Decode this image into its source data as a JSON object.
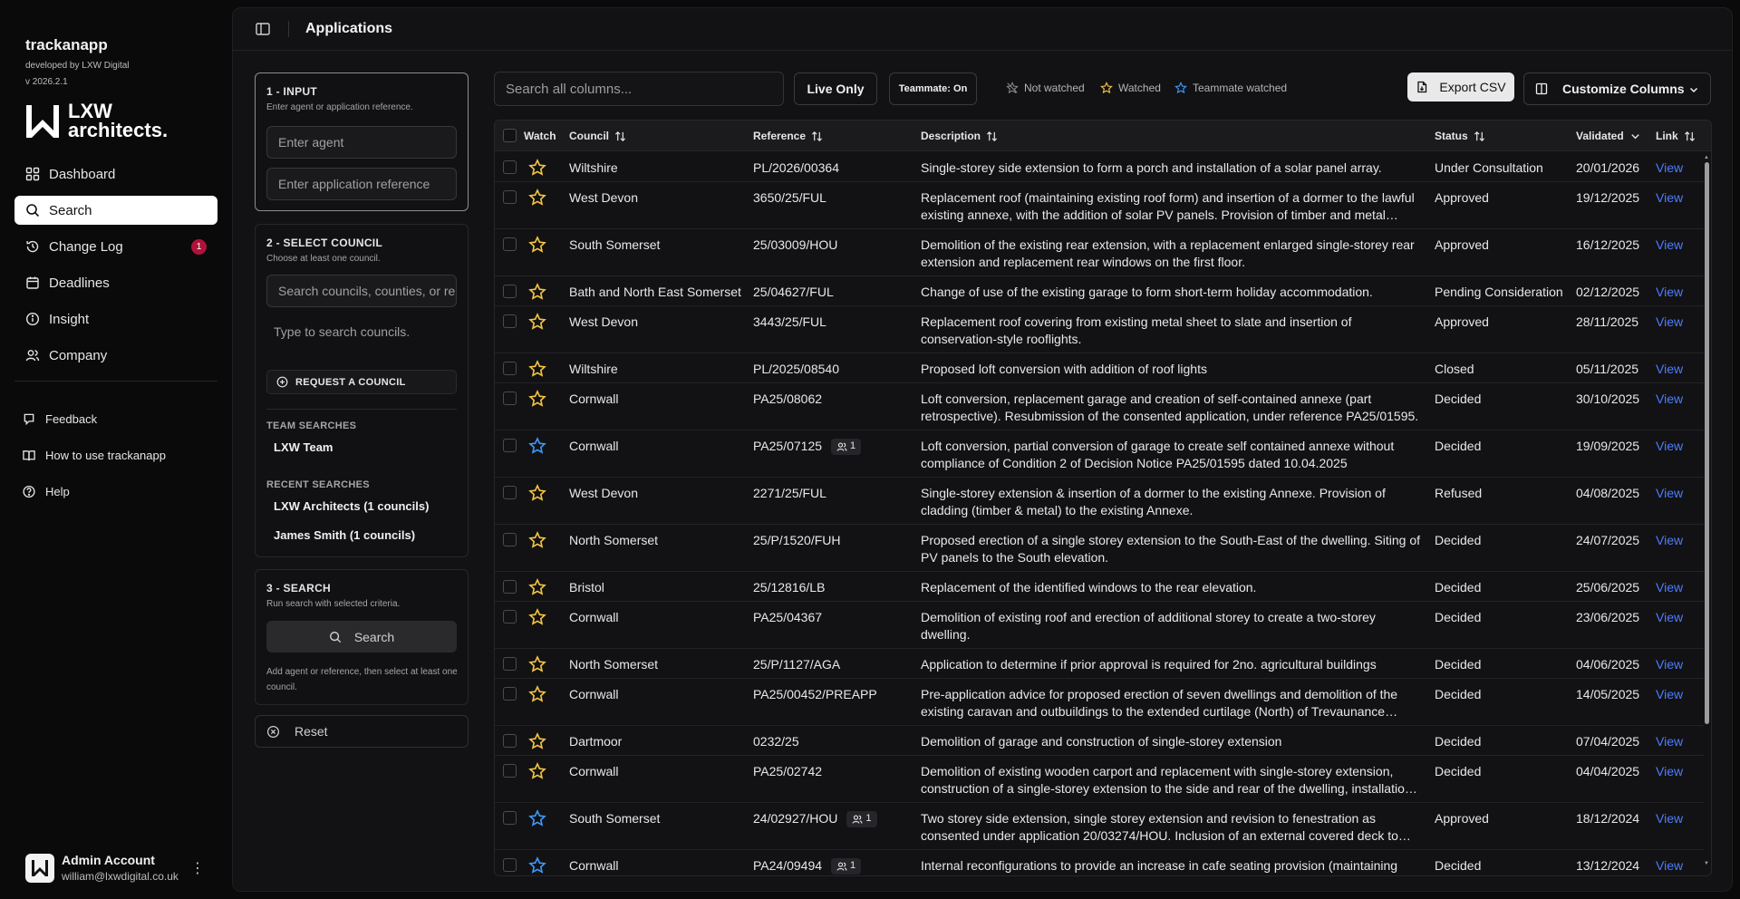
{
  "app": {
    "name": "trackanapp",
    "developer": "developed by LXW Digital",
    "version": "v 2026.2.1",
    "logo_line1": "LXW",
    "logo_line2": "architects."
  },
  "nav": [
    {
      "label": "Dashboard",
      "icon": "dashboard-icon"
    },
    {
      "label": "Search",
      "icon": "search-icon",
      "active": true
    },
    {
      "label": "Change Log",
      "icon": "history-icon",
      "badge": "1"
    },
    {
      "label": "Deadlines",
      "icon": "calendar-icon"
    },
    {
      "label": "Insight",
      "icon": "info-icon"
    },
    {
      "label": "Company",
      "icon": "users-icon"
    }
  ],
  "nav_secondary": [
    {
      "label": "Feedback",
      "icon": "feedback-icon"
    },
    {
      "label": "How to use trackanapp",
      "icon": "book-icon"
    },
    {
      "label": "Help",
      "icon": "help-icon"
    }
  ],
  "account": {
    "name": "Admin Account",
    "email": "william@lxwdigital.co.uk"
  },
  "page": {
    "title": "Applications"
  },
  "input_panel": {
    "title": "1 - INPUT",
    "subtitle": "Enter agent or application reference.",
    "agent_placeholder": "Enter agent",
    "reference_placeholder": "Enter application reference"
  },
  "council_panel": {
    "title": "2 - SELECT COUNCIL",
    "subtitle": "Choose at least one council.",
    "search_placeholder": "Search councils, counties, or regions",
    "hint": "Type to search councils.",
    "request_label": "REQUEST A COUNCIL",
    "team_label": "TEAM SEARCHES",
    "team_items": [
      "LXW Team"
    ],
    "recent_label": "RECENT SEARCHES",
    "recent_items": [
      "LXW Architects (1 councils)",
      "James Smith (1 councils)"
    ]
  },
  "search_panel": {
    "title": "3 - SEARCH",
    "subtitle": "Run search with selected criteria.",
    "button": "Search",
    "note": "Add agent or reference, then select at least one council."
  },
  "reset_label": "Reset",
  "toolbar": {
    "search_placeholder": "Search all columns...",
    "live_only": "Live Only",
    "teammate": "Teammate: On",
    "legend": [
      "Not watched",
      "Watched",
      "Teammate watched"
    ],
    "export": "Export CSV",
    "customize": "Customize Columns"
  },
  "colors": {
    "watched": "#f5c542",
    "teammate": "#3b9bff",
    "not_watched": "#8a8a8d",
    "link": "#4c7dff",
    "badge": "#b0123a"
  },
  "table": {
    "headers": {
      "watch": "Watch",
      "council": "Council",
      "reference": "Reference",
      "description": "Description",
      "status": "Status",
      "validated": "Validated",
      "link": "Link"
    },
    "rows": [
      {
        "watch": "watched",
        "council": "Wiltshire",
        "reference": "PL/2026/00364",
        "description": "Single-storey side extension to form a porch and installation of a solar panel array.",
        "status": "Under Consultation",
        "validated": "20/01/2026",
        "link": "View"
      },
      {
        "watch": "watched",
        "council": "West Devon",
        "reference": "3650/25/FUL",
        "description": "Replacement roof (maintaining existing roof form) and insertion of a dormer to the lawful existing annexe, with the addition of solar PV panels. Provision of timber and metal…",
        "status": "Approved",
        "validated": "19/12/2025",
        "link": "View"
      },
      {
        "watch": "watched",
        "council": "South Somerset",
        "reference": "25/03009/HOU",
        "description": "Demolition of the existing rear extension, with a replacement enlarged single-storey rear extension and replacement rear windows on the first floor.",
        "status": "Approved",
        "validated": "16/12/2025",
        "link": "View"
      },
      {
        "watch": "watched",
        "council": "Bath and North East Somerset",
        "reference": "25/04627/FUL",
        "description": "Change of use of the existing garage to form short-term holiday accommodation.",
        "status": "Pending Consideration",
        "validated": "02/12/2025",
        "link": "View"
      },
      {
        "watch": "watched",
        "council": "West Devon",
        "reference": "3443/25/FUL",
        "description": "Replacement roof covering from existing metal sheet to slate and insertion of conservation-style rooflights.",
        "status": "Approved",
        "validated": "28/11/2025",
        "link": "View"
      },
      {
        "watch": "watched",
        "council": "Wiltshire",
        "reference": "PL/2025/08540",
        "description": "Proposed loft conversion with addition of roof lights",
        "status": "Closed",
        "validated": "05/11/2025",
        "link": "View"
      },
      {
        "watch": "watched",
        "council": "Cornwall",
        "reference": "PA25/08062",
        "description": "Loft conversion, replacement garage and creation of self-contained annexe (part retrospective). Resubmission of the consented application, under reference PA25/01595.",
        "status": "Decided",
        "validated": "30/10/2025",
        "link": "View"
      },
      {
        "watch": "teammate",
        "council": "Cornwall",
        "reference": "PA25/07125",
        "teammates": "1",
        "description": "Loft conversion, partial conversion of garage to create self contained annexe without compliance of Condition 2 of Decision Notice PA25/01595 dated 10.04.2025",
        "status": "Decided",
        "validated": "19/09/2025",
        "link": "View"
      },
      {
        "watch": "watched",
        "council": "West Devon",
        "reference": "2271/25/FUL",
        "description": "Single-storey extension & insertion of a dormer to the existing Annexe. Provision of cladding (timber & metal) to the existing Annexe.",
        "status": "Refused",
        "validated": "04/08/2025",
        "link": "View"
      },
      {
        "watch": "watched",
        "council": "North Somerset",
        "reference": "25/P/1520/FUH",
        "description": "Proposed erection of a single storey extension to the South-East of the dwelling. Siting of PV panels to the South elevation.",
        "status": "Decided",
        "validated": "24/07/2025",
        "link": "View"
      },
      {
        "watch": "watched",
        "council": "Bristol",
        "reference": "25/12816/LB",
        "description": "Replacement of the identified windows to the rear elevation.",
        "status": "Decided",
        "validated": "25/06/2025",
        "link": "View"
      },
      {
        "watch": "watched",
        "council": "Cornwall",
        "reference": "PA25/04367",
        "description": "Demolition of existing roof and erection of additional storey to create a two-storey dwelling.",
        "status": "Decided",
        "validated": "23/06/2025",
        "link": "View"
      },
      {
        "watch": "watched",
        "council": "North Somerset",
        "reference": "25/P/1127/AGA",
        "description": "Application to determine if prior approval is required for 2no. agricultural buildings",
        "status": "Decided",
        "validated": "04/06/2025",
        "link": "View"
      },
      {
        "watch": "watched",
        "council": "Cornwall",
        "reference": "PA25/00452/PREAPP",
        "description": "Pre-application advice for proposed erection of seven dwellings and demolition of the existing caravan and outbuildings to the extended curtilage (North) of Trevaunance…",
        "status": "Decided",
        "validated": "14/05/2025",
        "link": "View"
      },
      {
        "watch": "watched",
        "council": "Dartmoor",
        "reference": "0232/25",
        "description": "Demolition of garage and construction of single-storey extension",
        "status": "Decided",
        "validated": "07/04/2025",
        "link": "View"
      },
      {
        "watch": "watched",
        "council": "Cornwall",
        "reference": "PA25/02742",
        "description": "Demolition of existing wooden carport and replacement with single-storey extension, construction of a single-storey extension to the side and rear of the dwelling, installatio…",
        "status": "Decided",
        "validated": "04/04/2025",
        "link": "View"
      },
      {
        "watch": "teammate",
        "council": "South Somerset",
        "reference": "24/02927/HOU",
        "teammates": "1",
        "description": "Two storey side extension, single storey extension and revision to fenestration as consented under application 20/03274/HOU. Inclusion of an external covered deck to…",
        "status": "Approved",
        "validated": "18/12/2024",
        "link": "View"
      },
      {
        "watch": "teammate",
        "council": "Cornwall",
        "reference": "PA24/09494",
        "teammates": "1",
        "description": "Internal reconfigurations to provide an increase in cafe seating provision (maintaining",
        "status": "Decided",
        "validated": "13/12/2024",
        "link": "View"
      }
    ]
  }
}
